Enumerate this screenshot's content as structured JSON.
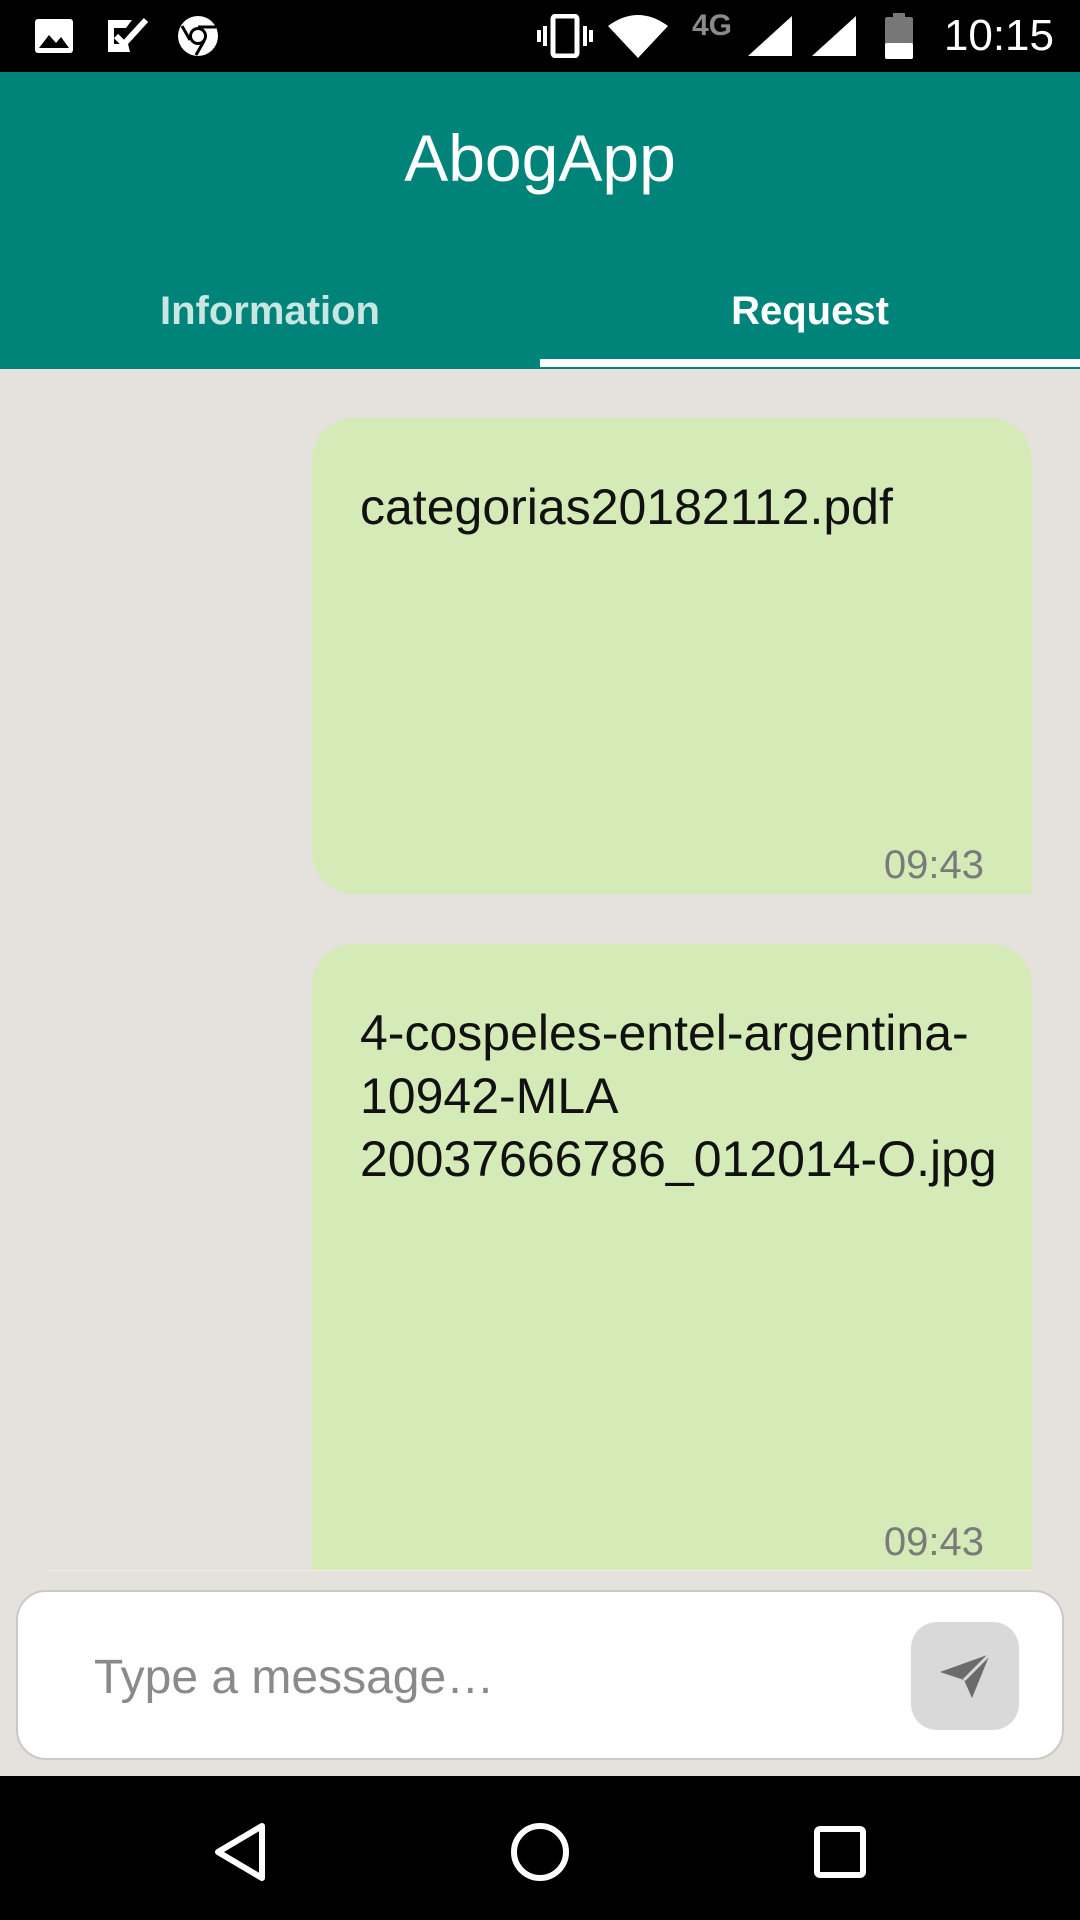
{
  "status_bar": {
    "time": "10:15",
    "network": "4G",
    "icons": [
      "image-icon",
      "task-check-icon",
      "chrome-icon",
      "vibrate-icon",
      "wifi-icon",
      "signal-icon",
      "signal-icon",
      "battery-icon"
    ]
  },
  "app": {
    "title": "AbogApp",
    "accent_color": "#00847a",
    "bubble_color": "#d4ebb8"
  },
  "tabs": [
    {
      "label": "Information",
      "selected": false
    },
    {
      "label": "Request",
      "selected": true
    }
  ],
  "messages": [
    {
      "text": "categorias20182112.pdf",
      "time": "09:43"
    },
    {
      "text": "4-cospeles-entel-argentina-10942-MLA 20037666786_012014-O.jpg",
      "time": "09:43"
    }
  ],
  "composer": {
    "placeholder": "Type a message…",
    "value": "",
    "send_icon": "send-icon"
  },
  "nav_bar": {
    "icons": [
      "back-icon",
      "home-icon",
      "recents-icon"
    ]
  }
}
